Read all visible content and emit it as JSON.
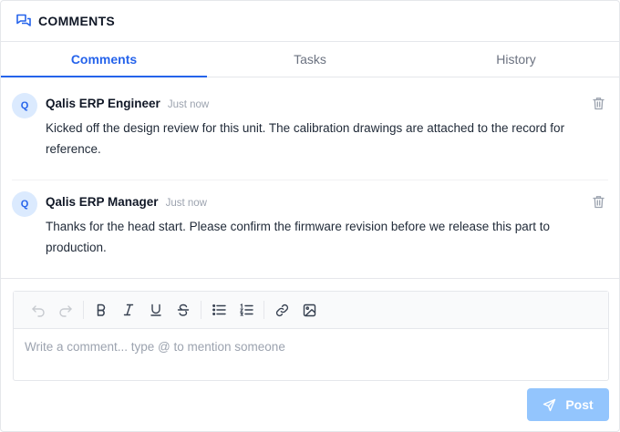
{
  "header": {
    "title": "COMMENTS",
    "icon": "comments-icon"
  },
  "tabs": [
    {
      "label": "Comments",
      "active": true
    },
    {
      "label": "Tasks",
      "active": false
    },
    {
      "label": "History",
      "active": false
    }
  ],
  "comments": [
    {
      "avatar": "Q",
      "author": "Qalis ERP Engineer",
      "time": "Just now",
      "text": "Kicked off the design review for this unit. The calibration drawings are attached to the record for reference."
    },
    {
      "avatar": "Q",
      "author": "Qalis ERP Manager",
      "time": "Just now",
      "text": "Thanks for the head start. Please confirm the firmware revision before we release this part to production."
    }
  ],
  "editor": {
    "placeholder": "Write a comment... type @ to mention someone",
    "toolbar": [
      "undo-icon",
      "redo-icon",
      "bold-icon",
      "italic-icon",
      "underline-icon",
      "strikethrough-icon",
      "bullet-list-icon",
      "numbered-list-icon",
      "link-icon",
      "image-icon"
    ]
  },
  "post_button": {
    "label": "Post",
    "icon": "send-icon"
  },
  "colors": {
    "accent": "#2563eb",
    "post_disabled": "#93c5fd",
    "avatar_bg": "#dbeafe"
  }
}
